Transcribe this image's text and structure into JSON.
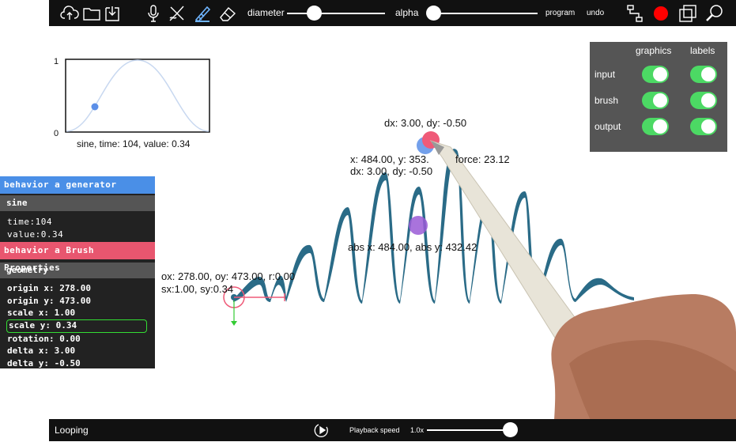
{
  "toolbar": {
    "diameter_label": "diameter",
    "alpha_label": "alpha",
    "diameter_value": 0.29,
    "alpha_value": 0.06,
    "program_label": "program",
    "undo_label": "undo",
    "icons": [
      "cloud-upload-icon",
      "folder-icon",
      "download-icon",
      "microphone-icon",
      "pen-cross-icon",
      "brush-icon",
      "eraser-icon",
      "path-icon",
      "record-icon",
      "copy-icon",
      "search-icon"
    ],
    "record_color": "#ff0000"
  },
  "graph": {
    "y_max_label": "1",
    "y_min_label": "0",
    "caption": "sine, time: 104, value: 0.34"
  },
  "settings": {
    "col_graphics": "graphics",
    "col_labels": "labels",
    "rows": [
      {
        "label": "input",
        "graphics": true,
        "labels": true
      },
      {
        "label": "brush",
        "graphics": true,
        "labels": true
      },
      {
        "label": "output",
        "graphics": true,
        "labels": true
      }
    ],
    "toggle_color": "#4cd964"
  },
  "behavior": {
    "generator_title": "behavior a generator",
    "generator_color": "#4a8fe7",
    "generator_name": "sine",
    "time_line": "time:104",
    "value_line": "value:0.34",
    "brush_title": "behavior a Brush Properties",
    "brush_color": "#e8566f",
    "geometry_title": "geometry",
    "props": [
      "origin x: 278.00",
      "origin y: 473.00",
      "scale x: 1.00",
      "scale y: 0.34",
      "rotation: 0.00",
      "delta x: 3.00",
      "delta y: -0.50"
    ],
    "highlight_color": "#33dd33"
  },
  "overlays": {
    "dx_top": "dx: 3.00, dy: -0.50",
    "xy_line": "x: 484.00, y: 353.",
    "force_line": "force: 23.12",
    "dx_line2": "dx: 3.00, dy: -0.50",
    "abs_line": "abs x: 484.00, abs y: 432.42",
    "origin_line": "ox: 278.00, oy: 473.00, r:0.00",
    "scale_line": "sx:1.00, sy:0.34"
  },
  "bottombar": {
    "looping_label": "Looping",
    "playback_label": "Playback speed",
    "speed_value": "1.0x",
    "speed_slider_value": 0.95
  },
  "colors": {
    "stroke": "#2a6b87",
    "sine_line": "#c8d8f0",
    "sine_dot": "#5b8fe8",
    "pink": "#ef5a78",
    "purple": "#9a5bd6"
  }
}
